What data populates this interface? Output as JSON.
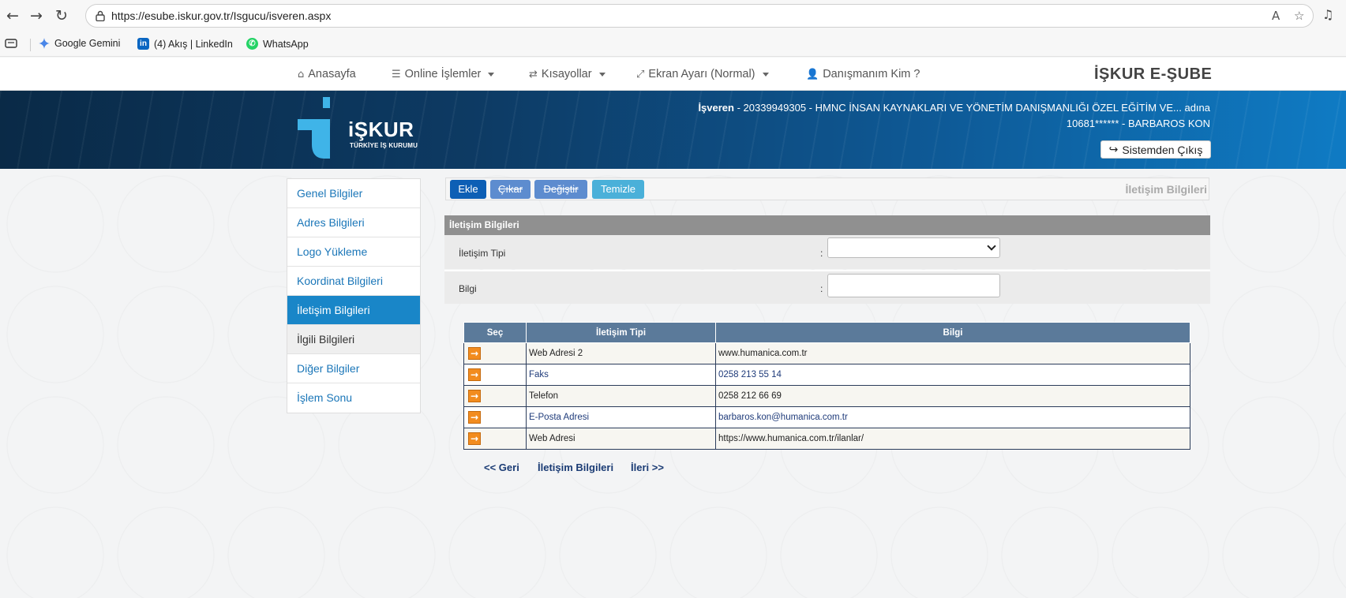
{
  "browser": {
    "url": "https://esube.iskur.gov.tr/Isgucu/isveren.aspx",
    "bookmarks": [
      {
        "label": "Google Gemini"
      },
      {
        "label": "(4) Akış | LinkedIn"
      },
      {
        "label": "WhatsApp"
      }
    ]
  },
  "site_nav": {
    "items": [
      {
        "label": "Anasayfa"
      },
      {
        "label": "Online İşlemler"
      },
      {
        "label": "Kısayollar"
      },
      {
        "label": "Ekran Ayarı (Normal)"
      },
      {
        "label": "Danışmanım Kim ?"
      }
    ],
    "brand": "İŞKUR E-ŞUBE"
  },
  "banner": {
    "logo_text": "iŞKUR",
    "logo_sub": "TÜRKİYE İŞ KURUMU",
    "user_role": "İşveren",
    "user_line1_rest": " - 20339949305 - HMNC İNSAN KAYNAKLARI VE YÖNETİM DANIŞMANLIĞI ÖZEL EĞİTİM VE... adına",
    "user_line2": "10681****** - BARBAROS KON",
    "logout_label": "Sistemden Çıkış"
  },
  "side_menu": {
    "items": [
      {
        "label": "Genel Bilgiler"
      },
      {
        "label": "Adres Bilgileri"
      },
      {
        "label": "Logo Yükleme"
      },
      {
        "label": "Koordinat Bilgileri"
      },
      {
        "label": "İletişim Bilgileri"
      },
      {
        "label": "İlgili Bilgileri"
      },
      {
        "label": "Diğer Bilgiler"
      },
      {
        "label": "İşlem Sonu"
      }
    ]
  },
  "toolbar": {
    "add_label": "Ekle",
    "remove_label": "Çıkar",
    "edit_label": "Değiştir",
    "clear_label": "Temizle",
    "title": "İletişim Bilgileri"
  },
  "form": {
    "header": "İletişim Bilgileri",
    "type_label": "İletişim Tipi",
    "info_label": "Bilgi",
    "colon": ":",
    "type_value": "",
    "info_value": ""
  },
  "table": {
    "headers": [
      "Seç",
      "İletişim Tipi",
      "Bilgi"
    ],
    "rows": [
      {
        "type": "Web Adresi 2",
        "info": "www.humanica.com.tr"
      },
      {
        "type": "Faks",
        "info": "0258 213 55 14"
      },
      {
        "type": "Telefon",
        "info": "0258 212 66 69"
      },
      {
        "type": "E-Posta Adresi",
        "info": "barbaros.kon@humanica.com.tr"
      },
      {
        "type": "Web Adresi",
        "info": "https://www.humanica.com.tr/ilanlar/"
      }
    ]
  },
  "pager": {
    "back": "<< Geri",
    "current": "İletişim Bilgileri",
    "next": "İleri >>"
  },
  "colors": {
    "accent": "#1986c8",
    "add_button": "#0d5fb5",
    "disabled_button": "#5d8ccf",
    "clear_button": "#4ab0d9",
    "table_header": "#5b7a9a",
    "select_arrow": "#f28c1f"
  }
}
